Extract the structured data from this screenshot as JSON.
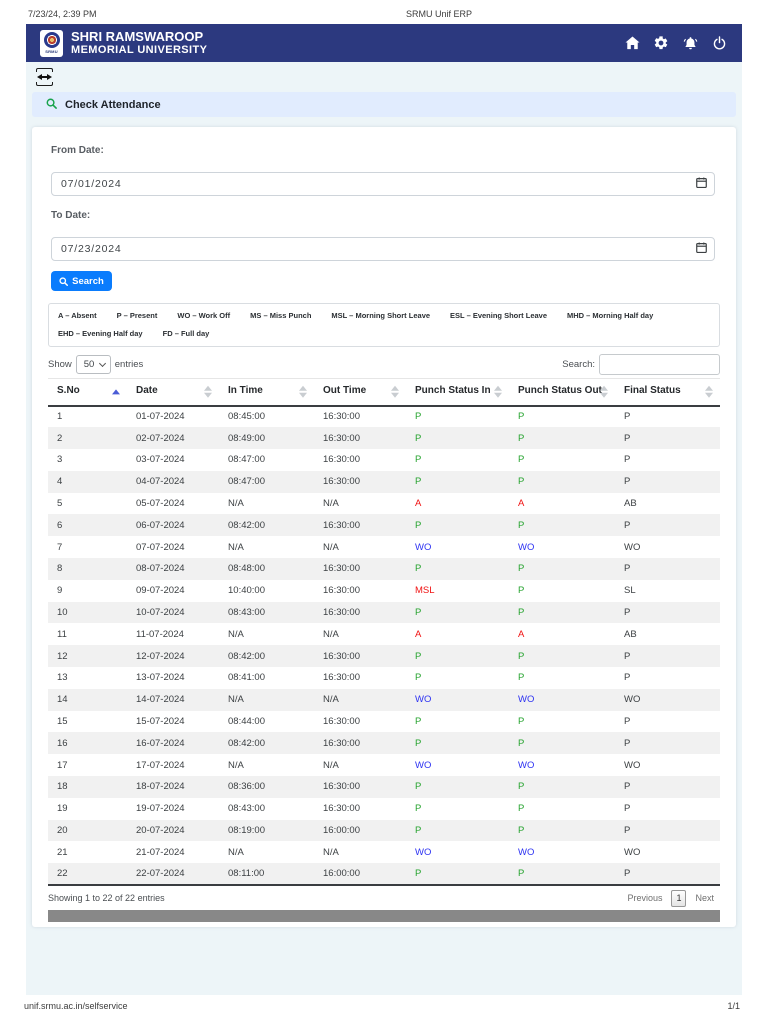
{
  "print": {
    "datetime": "7/23/24, 2:39 PM",
    "title": "SRMU Unif ERP",
    "url": "unif.srmu.ac.in/selfservice",
    "page_indicator": "1/1"
  },
  "navbar": {
    "brand_line1": "SHRI RAMSWAROOP",
    "brand_line2": "MEMORIAL UNIVERSITY",
    "logo_text": "SRMU"
  },
  "section": {
    "title": "Check Attendance"
  },
  "colors": {
    "navbar": "#2c397f",
    "section_bar": "#e1ecfe",
    "page_background": "#edf5f8",
    "accent_blue": "#0a7cfd",
    "status_green": "#25a32e",
    "status_red": "#f01212",
    "status_blue": "#2e33f2"
  },
  "form": {
    "from_label": "From Date:",
    "from_value": "07/01/2024",
    "to_label": "To Date:",
    "to_value": "07/23/2024",
    "search_button": "Search"
  },
  "legend": {
    "items": [
      "A – Absent",
      "P – Present",
      "WO – Work Off",
      "MS – Miss Punch",
      "MSL – Morning Short Leave",
      "ESL – Evening Short Leave",
      "MHD – Morning Half day",
      "EHD – Evening Half day",
      "FD – Full day"
    ]
  },
  "controls": {
    "show_label": "Show",
    "page_size": "50",
    "entries_label": "entries",
    "search_label": "Search:",
    "search_value": ""
  },
  "table": {
    "columns": [
      "S.No",
      "Date",
      "In Time",
      "Out Time",
      "Punch Status In",
      "Punch Status Out",
      "Final Status"
    ],
    "status_colors": {
      "P": "#25a32e",
      "A": "#f01212",
      "WO": "#2e33f2",
      "MSL": "#f01212"
    },
    "rows": [
      [
        "1",
        "01-07-2024",
        "08:45:00",
        "16:30:00",
        "P",
        "P",
        "P"
      ],
      [
        "2",
        "02-07-2024",
        "08:49:00",
        "16:30:00",
        "P",
        "P",
        "P"
      ],
      [
        "3",
        "03-07-2024",
        "08:47:00",
        "16:30:00",
        "P",
        "P",
        "P"
      ],
      [
        "4",
        "04-07-2024",
        "08:47:00",
        "16:30:00",
        "P",
        "P",
        "P"
      ],
      [
        "5",
        "05-07-2024",
        "N/A",
        "N/A",
        "A",
        "A",
        "AB"
      ],
      [
        "6",
        "06-07-2024",
        "08:42:00",
        "16:30:00",
        "P",
        "P",
        "P"
      ],
      [
        "7",
        "07-07-2024",
        "N/A",
        "N/A",
        "WO",
        "WO",
        "WO"
      ],
      [
        "8",
        "08-07-2024",
        "08:48:00",
        "16:30:00",
        "P",
        "P",
        "P"
      ],
      [
        "9",
        "09-07-2024",
        "10:40:00",
        "16:30:00",
        "MSL",
        "P",
        "SL"
      ],
      [
        "10",
        "10-07-2024",
        "08:43:00",
        "16:30:00",
        "P",
        "P",
        "P"
      ],
      [
        "11",
        "11-07-2024",
        "N/A",
        "N/A",
        "A",
        "A",
        "AB"
      ],
      [
        "12",
        "12-07-2024",
        "08:42:00",
        "16:30:00",
        "P",
        "P",
        "P"
      ],
      [
        "13",
        "13-07-2024",
        "08:41:00",
        "16:30:00",
        "P",
        "P",
        "P"
      ],
      [
        "14",
        "14-07-2024",
        "N/A",
        "N/A",
        "WO",
        "WO",
        "WO"
      ],
      [
        "15",
        "15-07-2024",
        "08:44:00",
        "16:30:00",
        "P",
        "P",
        "P"
      ],
      [
        "16",
        "16-07-2024",
        "08:42:00",
        "16:30:00",
        "P",
        "P",
        "P"
      ],
      [
        "17",
        "17-07-2024",
        "N/A",
        "N/A",
        "WO",
        "WO",
        "WO"
      ],
      [
        "18",
        "18-07-2024",
        "08:36:00",
        "16:30:00",
        "P",
        "P",
        "P"
      ],
      [
        "19",
        "19-07-2024",
        "08:43:00",
        "16:30:00",
        "P",
        "P",
        "P"
      ],
      [
        "20",
        "20-07-2024",
        "08:19:00",
        "16:00:00",
        "P",
        "P",
        "P"
      ],
      [
        "21",
        "21-07-2024",
        "N/A",
        "N/A",
        "WO",
        "WO",
        "WO"
      ],
      [
        "22",
        "22-07-2024",
        "08:11:00",
        "16:00:00",
        "P",
        "P",
        "P"
      ]
    ]
  },
  "pagination": {
    "showing_text": "Showing 1 to 22 of 22 entries",
    "previous": "Previous",
    "page": "1",
    "next": "Next"
  }
}
